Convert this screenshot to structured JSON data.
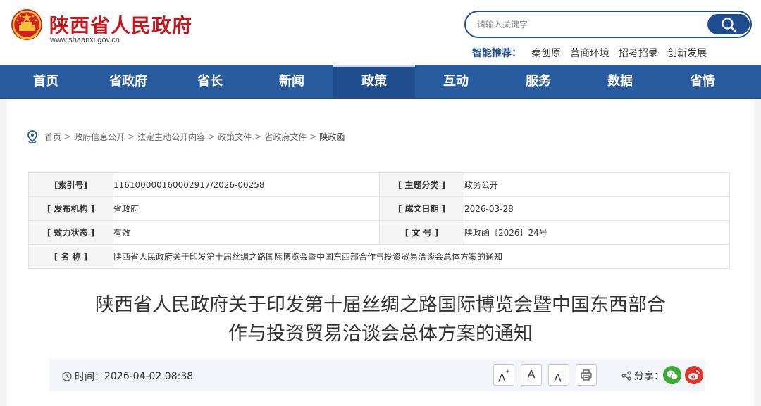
{
  "header": {
    "site_name": "陕西省人民政府",
    "site_url": "www.shaanxi.gov.cn",
    "search_placeholder": "请输入关键字",
    "recommend_label": "智能推荐：",
    "recommend_items": [
      "秦创原",
      "营商环境",
      "招考招录",
      "创新发展"
    ]
  },
  "nav": {
    "items": [
      "首页",
      "省政府",
      "省长",
      "新闻",
      "政策",
      "互动",
      "服务",
      "数据",
      "省情"
    ],
    "active": "政策"
  },
  "breadcrumb": {
    "items": [
      "首页",
      "政府信息公开",
      "法定主动公开内容",
      "政策文件",
      "省政府文件"
    ],
    "separator": ">",
    "current": "陕政函"
  },
  "meta": {
    "index_no_label": "[索引号]",
    "index_no": "116100000160002917/2026-00258",
    "topic_label": "[ 主题分类 ]",
    "topic": "政务公开",
    "issuer_label": "[ 发布机构 ]",
    "issuer": "省政府",
    "date_label": "[ 成文日期 ]",
    "date": "2026-03-28",
    "status_label": "[ 效力状态 ]",
    "status": "有效",
    "doc_no_label": "[ 文 号 ]",
    "doc_no": "陕政函〔2026〕24号",
    "name_label": "[ 名 称 ]",
    "name": "陕西省人民政府关于印发第十届丝绸之路国际博览会暨中国东西部合作与投资贸易洽谈会总体方案的通知"
  },
  "article": {
    "title_line1": "陕西省人民政府关于印发第十届丝绸之路国际博览会暨中国东西部合",
    "title_line2": "作与投资贸易洽谈会总体方案的通知",
    "time_label": "时间：",
    "time_value": "2026-04-02 08:38",
    "font_larger": "A",
    "font_normal": "A",
    "font_smaller": "A",
    "share_label": "分享："
  },
  "colors": {
    "brand_red": "#c8161d",
    "nav_blue": "#285c9e",
    "nav_active": "#1f4d8e",
    "wechat_green": "#3aaa35",
    "weibo_red": "#e0342a"
  }
}
